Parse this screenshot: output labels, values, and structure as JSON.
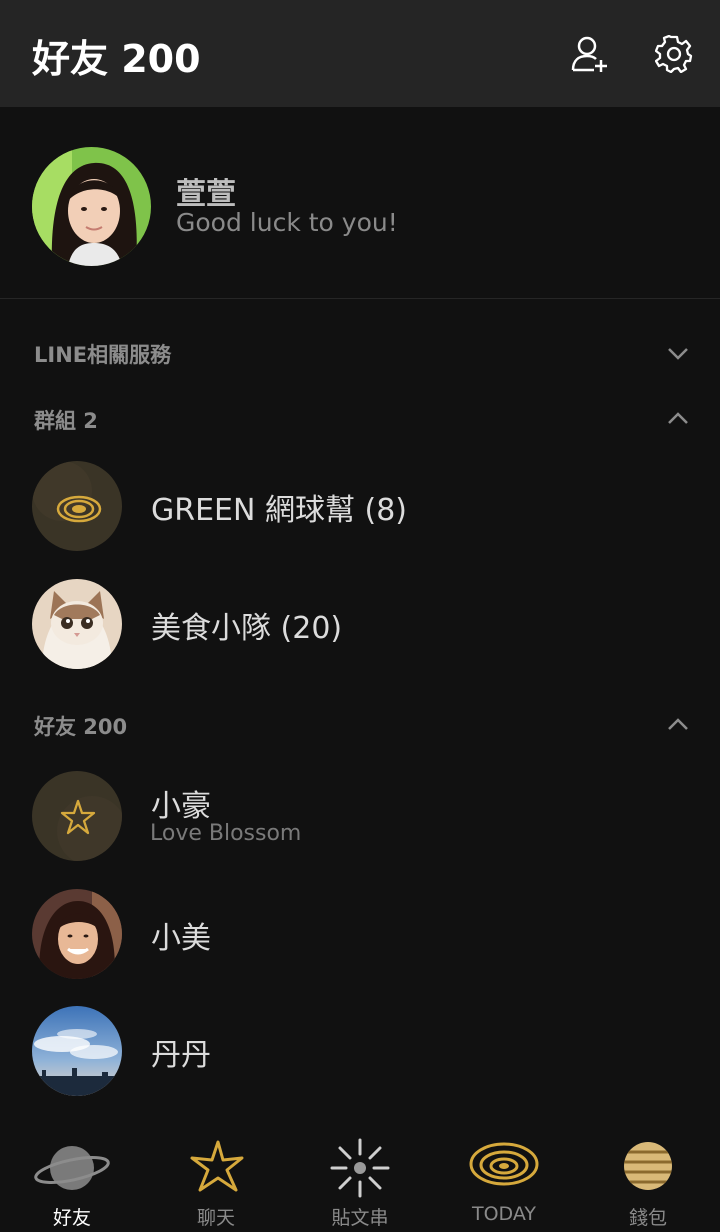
{
  "header": {
    "title": "好友 200",
    "add_friend_icon": "add-friend-icon",
    "settings_icon": "gear-icon"
  },
  "profile": {
    "name": "萱萱",
    "status": "Good luck to you!"
  },
  "sections": {
    "services": {
      "label": "LINE相關服務",
      "state": "collapsed"
    },
    "groups": {
      "label": "群組 2",
      "state": "expanded"
    },
    "friends": {
      "label": "好友 200",
      "state": "expanded"
    }
  },
  "groups": [
    {
      "name": "GREEN 網球幫 (8)",
      "avatar": "concentric-rings-icon"
    },
    {
      "name": "美食小隊 (20)",
      "avatar": "cat-photo"
    }
  ],
  "friends": [
    {
      "name": "小豪",
      "status": "Love Blossom",
      "avatar": "star-icon"
    },
    {
      "name": "小美",
      "status": "",
      "avatar": "woman-photo"
    },
    {
      "name": "丹丹",
      "status": "",
      "avatar": "sky-photo"
    }
  ],
  "tabs": [
    {
      "label": "好友",
      "icon": "planet-icon",
      "active": true
    },
    {
      "label": "聊天",
      "icon": "star-icon",
      "active": false
    },
    {
      "label": "貼文串",
      "icon": "sun-icon",
      "active": false
    },
    {
      "label": "TODAY",
      "icon": "rings-icon",
      "active": false
    },
    {
      "label": "錢包",
      "icon": "striped-planet-icon",
      "active": false
    }
  ],
  "colors": {
    "background": "#111111",
    "header": "#252525",
    "accent_gold": "#d6a93c"
  }
}
